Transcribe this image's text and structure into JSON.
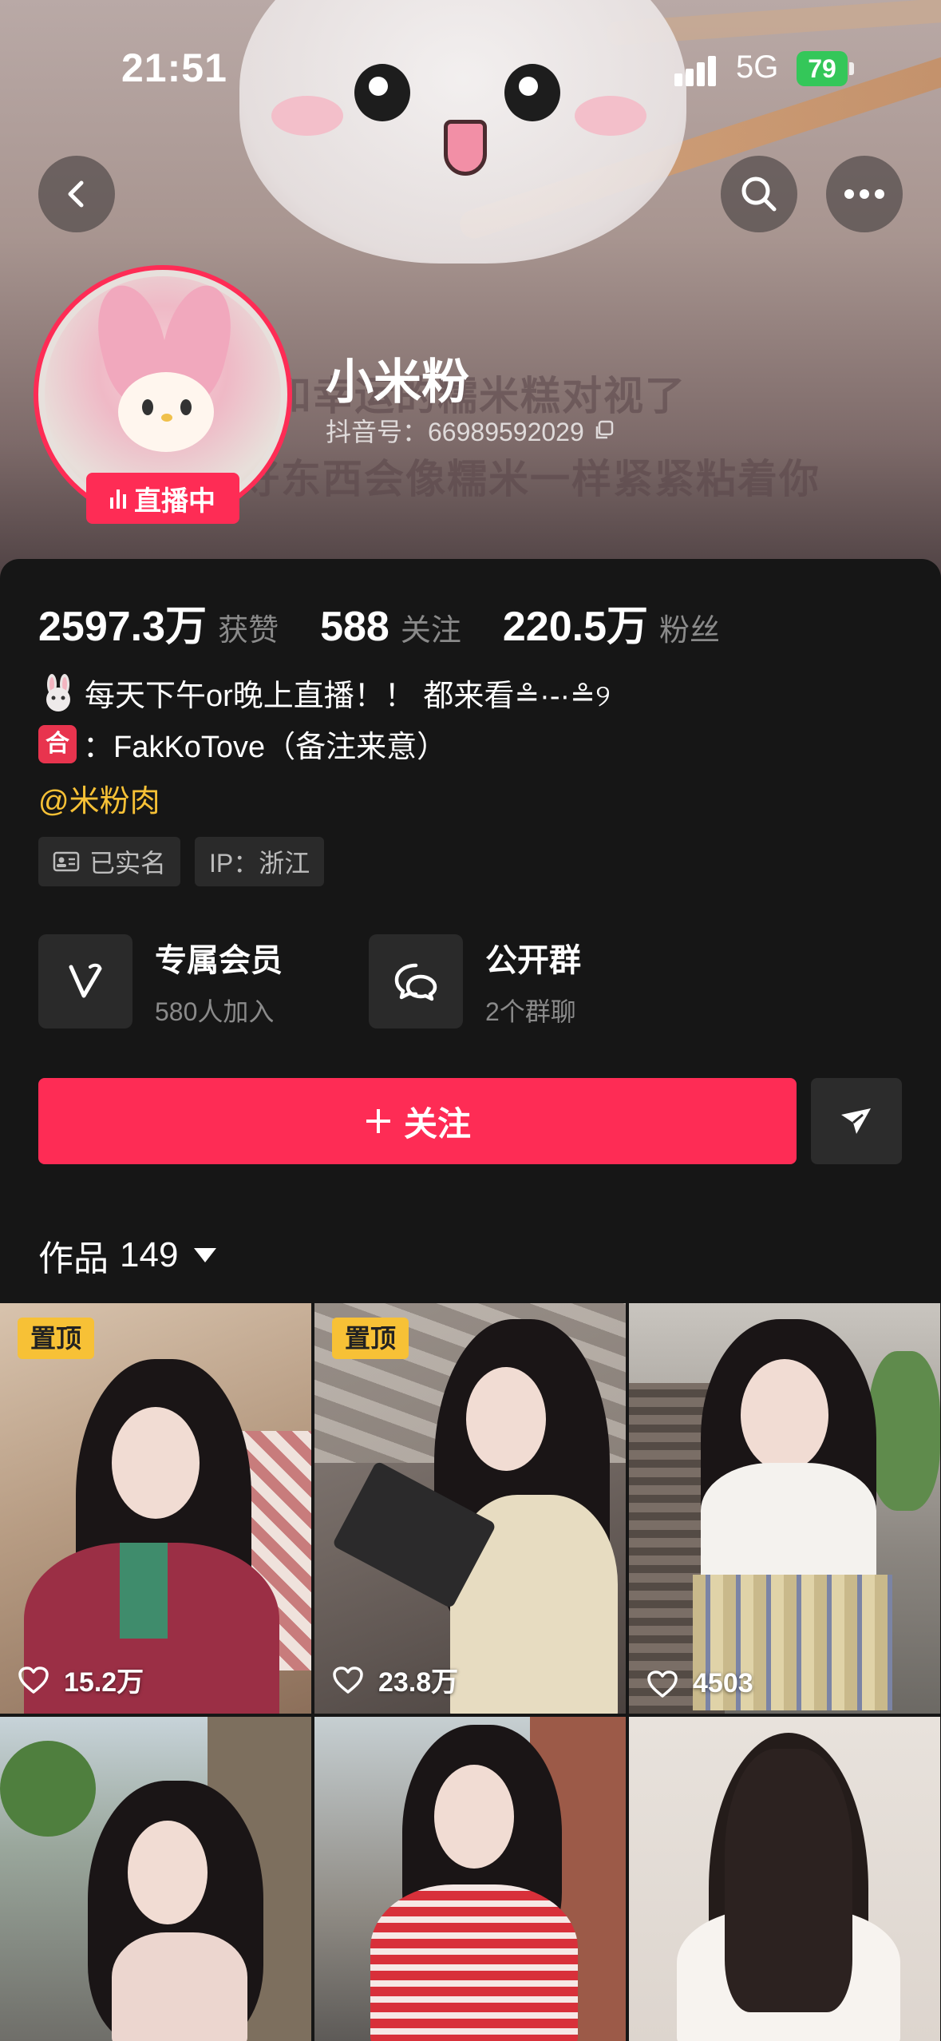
{
  "status_bar": {
    "time": "21:51",
    "network": "5G",
    "battery": "79"
  },
  "profile": {
    "nickname": "小米粉",
    "douyin_id": "抖音号：66989592029",
    "live_badge": "直播中"
  },
  "banner_text": {
    "line1": "和幸运的糯米糕对视了",
    "line2": "好东西会像糯米一样紧紧粘着你"
  },
  "stats": [
    {
      "value": "2597.3万",
      "label": "获赞"
    },
    {
      "value": "588",
      "label": "关注"
    },
    {
      "value": "220.5万",
      "label": "粉丝"
    }
  ],
  "bio": {
    "line1": "每天下午or晚上直播！！ 都来看≗·-·≗୨",
    "line2_badge": "合",
    "line2": "：FakKoTove（备注来意）",
    "mention": "@米粉肉"
  },
  "tags": [
    {
      "icon": "id-card-icon",
      "label": "已实名"
    },
    {
      "label": "IP：浙江"
    }
  ],
  "features": [
    {
      "icon": "v-member-icon",
      "title": "专属会员",
      "subtitle": "580人加入"
    },
    {
      "icon": "group-chat-icon",
      "title": "公开群",
      "subtitle": "2个群聊"
    }
  ],
  "actions": {
    "follow_label": "关注"
  },
  "works": {
    "label": "作品",
    "count": "149"
  },
  "videos": [
    {
      "pinned": true,
      "pin_label": "置顶",
      "likes": "15.2万"
    },
    {
      "pinned": true,
      "pin_label": "置顶",
      "likes": "23.8万"
    },
    {
      "pinned": false,
      "likes": "4503"
    },
    {
      "pinned": false
    },
    {
      "pinned": false
    },
    {
      "pinned": false
    }
  ],
  "colors": {
    "accent": "#fe2c55",
    "mention": "#f7c136",
    "pin": "#f7c136"
  }
}
